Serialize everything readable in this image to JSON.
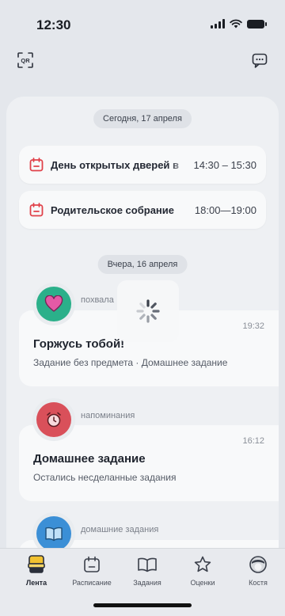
{
  "status_bar": {
    "time": "12:30"
  },
  "top_bar": {
    "qr_icon": "qr-code-icon",
    "chat_icon": "chat-icon"
  },
  "feed": {
    "today": {
      "date_label": "Сегодня, 17 апреля",
      "events": [
        {
          "title": "День открытых дверей в",
          "time": "14:30 – 15:30",
          "icon": "calendar-icon"
        },
        {
          "title": "Родительское собрание",
          "time": "18:00—19:00",
          "icon": "calendar-icon"
        }
      ]
    },
    "yesterday": {
      "date_label": "Вчера, 16 апреля",
      "items": [
        {
          "category": "похвала",
          "icon": "heart-icon",
          "time": "19:32",
          "title": "Горжусь тобой!",
          "subtitle": "Задание без предмета · Домашнее задание"
        },
        {
          "category": "напоминания",
          "icon": "alarm-clock-icon",
          "time": "16:12",
          "title": "Домашнее задание",
          "subtitle": "Остались несделанные задания"
        },
        {
          "category": "домашние задания",
          "icon": "book-icon"
        }
      ]
    }
  },
  "loader": {
    "icon": "spinner-icon"
  },
  "tabbar": {
    "tabs": [
      {
        "label": "Лента",
        "icon": "feed-icon",
        "active": true
      },
      {
        "label": "Расписание",
        "icon": "calendar-icon",
        "active": false
      },
      {
        "label": "Задания",
        "icon": "book-icon",
        "active": false
      },
      {
        "label": "Оценки",
        "icon": "star-icon",
        "active": false
      },
      {
        "label": "Костя",
        "icon": "avatar-icon",
        "active": false
      }
    ]
  },
  "colors": {
    "calendar_accent": "#e0424a",
    "praise": "#2bb08a",
    "reminder": "#d9505a",
    "homework": "#3b8fd6"
  }
}
